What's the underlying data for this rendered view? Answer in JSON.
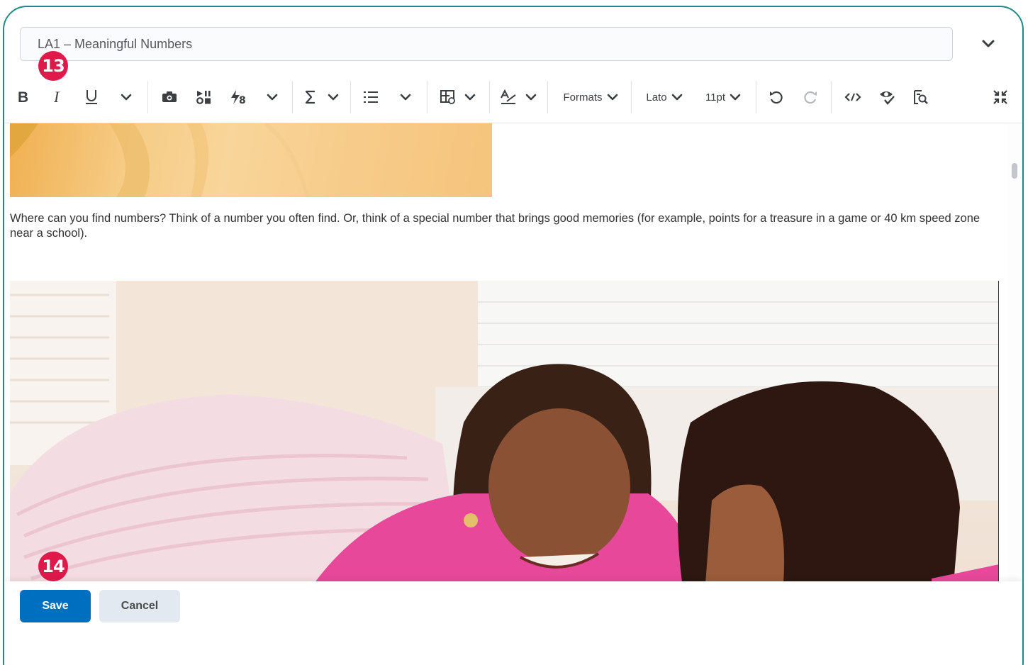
{
  "editor": {
    "title_value": "LA1 – Meaningful Numbers",
    "paragraph": "Where can you find numbers? Think of a number you often find. Or, think of a special number that brings good memories (for example, points for a treasure in a game or 40 km speed zone near a school)."
  },
  "callouts": {
    "first": "13",
    "second": "14"
  },
  "toolbar": {
    "formats_label": "Formats",
    "font_label": "Lato",
    "size_label": "11pt",
    "icons": [
      "bold-icon",
      "italic-icon",
      "underline-icon",
      "chevron-down-icon",
      "insert-image-icon",
      "insert-stuff-icon",
      "equation-icon",
      "chevron-down-icon",
      "sum-icon",
      "chevron-down-icon",
      "list-icon",
      "chevron-down-icon",
      "table-icon",
      "chevron-down-icon",
      "spellcheck-icon",
      "chevron-down-icon",
      "undo-icon",
      "redo-icon",
      "source-code-icon",
      "accessibility-check-icon",
      "preview-icon",
      "fullscreen-exit-icon"
    ]
  },
  "footer": {
    "save_label": "Save",
    "cancel_label": "Cancel"
  },
  "colors": {
    "frame": "#1f8a84",
    "callout": "#e0194b",
    "primary": "#006fbf",
    "secondary": "#e3e9f1"
  }
}
